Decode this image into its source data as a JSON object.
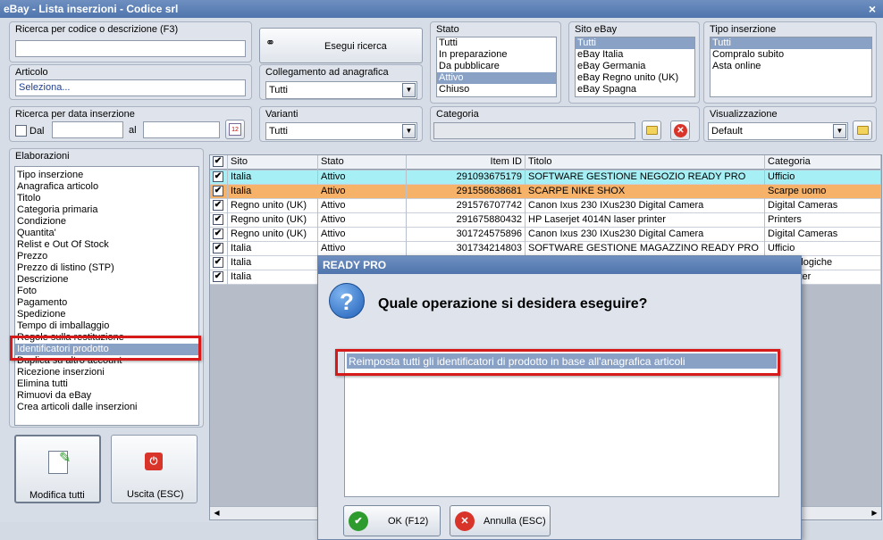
{
  "window": {
    "title": "eBay - Lista inserzioni - Codice srl",
    "close": "×"
  },
  "search": {
    "label": "Ricerca per codice o descrizione (F3)",
    "value": "",
    "button": "Esegui ricerca"
  },
  "articolo": {
    "label": "Articolo",
    "value": "Seleziona..."
  },
  "collegamento": {
    "label": "Collegamento ad anagrafica",
    "value": "Tutti"
  },
  "data_inserzione": {
    "label": "Ricerca per data inserzione",
    "dal": "Dal",
    "al": "al",
    "calendar": "12"
  },
  "varianti": {
    "label": "Varianti",
    "value": "Tutti"
  },
  "stato": {
    "label": "Stato",
    "items": [
      "Tutti",
      "In preparazione",
      "Da pubblicare",
      "Attivo",
      "Chiuso"
    ],
    "selected": 3
  },
  "sito": {
    "label": "Sito eBay",
    "items": [
      "Tutti",
      "eBay Italia",
      "eBay Germania",
      "eBay Regno unito (UK)",
      "eBay Spagna"
    ],
    "selected": 0
  },
  "tipo": {
    "label": "Tipo inserzione",
    "items": [
      "Tutti",
      "Compralo subito",
      "Asta online"
    ],
    "selected": 0
  },
  "categoria": {
    "label": "Categoria",
    "value": ""
  },
  "visualizzazione": {
    "label": "Visualizzazione",
    "value": "Default"
  },
  "elaborazioni": {
    "label": "Elaborazioni",
    "items": [
      "Tipo inserzione",
      "Anagrafica articolo",
      "Titolo",
      "Categoria primaria",
      "Condizione",
      "Quantita'",
      "Relist e Out Of Stock",
      "Prezzo",
      "Prezzo di listino (STP)",
      "Descrizione",
      "Foto",
      "Pagamento",
      "Spedizione",
      "Tempo di imballaggio",
      "Regole sulla restituzione",
      "Identificatori prodotto",
      "Duplica su altro account",
      "Ricezione inserzioni",
      "Elimina tutti",
      "Rimuovi da eBay",
      "Crea articoli dalle inserzioni"
    ],
    "selected": 15
  },
  "buttons": {
    "modifica": "Modifica tutti",
    "uscita": "Uscita (ESC)"
  },
  "grid": {
    "headers": [
      "Sito",
      "Stato",
      "Item ID",
      "Titolo",
      "Categoria"
    ],
    "rows": [
      {
        "sito": "Italia",
        "stato": "Attivo",
        "id": "291093675179",
        "titolo": "SOFTWARE GESTIONE NEGOZIO READY PRO",
        "cat": "Ufficio",
        "hl": "cyan"
      },
      {
        "sito": "Italia",
        "stato": "Attivo",
        "id": "291558638681",
        "titolo": "SCARPE NIKE SHOX",
        "cat": "Scarpe uomo",
        "hl": "orange"
      },
      {
        "sito": "Regno unito (UK)",
        "stato": "Attivo",
        "id": "291576707742",
        "titolo": "Canon Ixus 230 IXus230 Digital Camera",
        "cat": "Digital Cameras",
        "hl": ""
      },
      {
        "sito": "Regno unito (UK)",
        "stato": "Attivo",
        "id": "291675880432",
        "titolo": "HP Laserjet 4014N laser printer",
        "cat": "Printers",
        "hl": ""
      },
      {
        "sito": "Regno unito (UK)",
        "stato": "Attivo",
        "id": "301724575896",
        "titolo": "Canon Ixus 230 IXus230 Digital Camera",
        "cat": "Digital Cameras",
        "hl": ""
      },
      {
        "sito": "Italia",
        "stato": "Attivo",
        "id": "301734214803",
        "titolo": "SOFTWARE GESTIONE MAGAZZINO READY PRO",
        "cat": "Ufficio",
        "hl": ""
      },
      {
        "sito": "Italia",
        "stato": "",
        "id": "",
        "titolo": "",
        "cat": "ere analogiche",
        "hl": ""
      },
      {
        "sito": "Italia",
        "stato": "",
        "id": "",
        "titolo": "",
        "cat": "ti e plotter",
        "hl": ""
      }
    ]
  },
  "dialog": {
    "title": "READY PRO",
    "question": "Quale operazione si desidera eseguire?",
    "option": "Reimposta tutti gli identificatori di prodotto in base all'anagrafica articoli",
    "ok": "OK (F12)",
    "cancel": "Annulla (ESC)"
  },
  "colors": {
    "accent": "#4f75ad",
    "selection": "#8aa1c6",
    "highlight_red": "#d61a1a"
  }
}
